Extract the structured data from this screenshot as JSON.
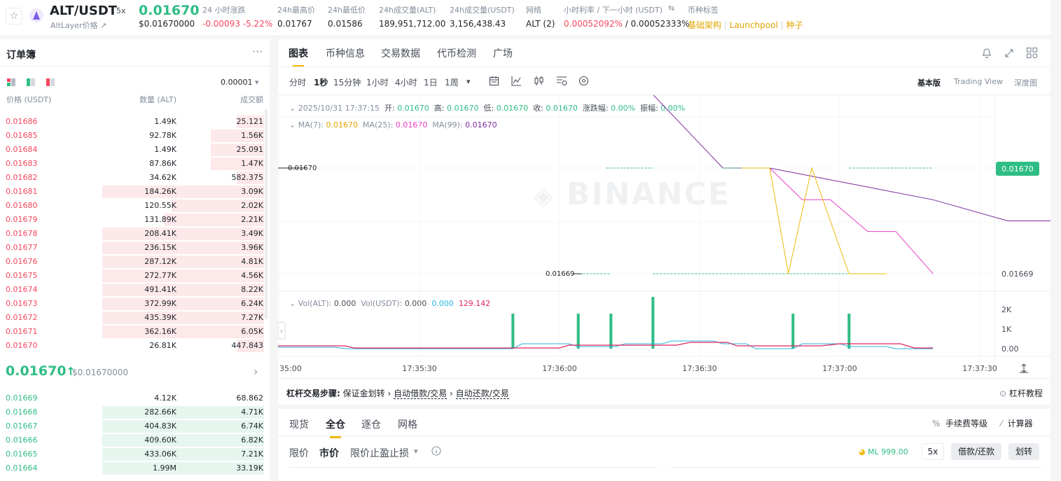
{
  "header": {
    "pair": "ALT/USDT",
    "leverage": "5x",
    "token_subtitle": "AltLayer价格",
    "price": "0.01670",
    "price_usd": "$0.01670000",
    "stats": [
      {
        "label": "24 小时涨跌",
        "value": "-0.00093 -5.22%",
        "color": "#f6465d"
      },
      {
        "label": "24h最高价",
        "value": "0.01767"
      },
      {
        "label": "24h最低价",
        "value": "0.01586"
      },
      {
        "label": "24h成交量(ALT)",
        "value": "189,951,712.00"
      },
      {
        "label": "24h成交量(USDT)",
        "value": "3,156,438.43"
      },
      {
        "label": "网络",
        "value": "ALT (2)"
      },
      {
        "label": "小时利率 / 下一小时 (USDT)",
        "value_red": "0.00052092%",
        "value_sep": " / ",
        "value_dark": "0.00052333%"
      },
      {
        "label": "币种标签",
        "tags": [
          "基础架构",
          "Launchpool",
          "种子"
        ]
      }
    ]
  },
  "orderbook": {
    "title": "订单簿",
    "precision": "0.00001",
    "columns": [
      "价格 (USDT)",
      "数量 (ALT)",
      "成交额"
    ],
    "asks": [
      {
        "price": "0.01686",
        "qty": "1.49K",
        "amount": "25.121",
        "depth": 0.17
      },
      {
        "price": "0.01685",
        "qty": "92.78K",
        "amount": "1.56K",
        "depth": 0.33
      },
      {
        "price": "0.01684",
        "qty": "1.49K",
        "amount": "25.091",
        "depth": 0.33
      },
      {
        "price": "0.01683",
        "qty": "87.86K",
        "amount": "1.47K",
        "depth": 0.33
      },
      {
        "price": "0.01682",
        "qty": "34.62K",
        "amount": "582.375",
        "depth": 0.17
      },
      {
        "price": "0.01681",
        "qty": "184.26K",
        "amount": "3.09K",
        "depth": 1.0
      },
      {
        "price": "0.01680",
        "qty": "120.55K",
        "amount": "2.02K",
        "depth": 0.57
      },
      {
        "price": "0.01679",
        "qty": "131.89K",
        "amount": "2.21K",
        "depth": 0.62
      },
      {
        "price": "0.01678",
        "qty": "208.41K",
        "amount": "3.49K",
        "depth": 1.0
      },
      {
        "price": "0.01677",
        "qty": "236.15K",
        "amount": "3.96K",
        "depth": 1.0
      },
      {
        "price": "0.01676",
        "qty": "287.12K",
        "amount": "4.81K",
        "depth": 1.0
      },
      {
        "price": "0.01675",
        "qty": "272.77K",
        "amount": "4.56K",
        "depth": 1.0
      },
      {
        "price": "0.01674",
        "qty": "491.41K",
        "amount": "8.22K",
        "depth": 1.0
      },
      {
        "price": "0.01673",
        "qty": "372.99K",
        "amount": "6.24K",
        "depth": 1.0
      },
      {
        "price": "0.01672",
        "qty": "435.39K",
        "amount": "7.27K",
        "depth": 1.0
      },
      {
        "price": "0.01671",
        "qty": "362.16K",
        "amount": "6.05K",
        "depth": 1.0
      },
      {
        "price": "0.01670",
        "qty": "26.81K",
        "amount": "447.843",
        "depth": 0.17
      }
    ],
    "mid_price": "0.01670",
    "mid_arrow": "↑",
    "mid_usd": "$0.01670000",
    "bids": [
      {
        "price": "0.01669",
        "qty": "4.12K",
        "amount": "68.862",
        "depth": 0.0
      },
      {
        "price": "0.01668",
        "qty": "282.66K",
        "amount": "4.71K",
        "depth": 1.0
      },
      {
        "price": "0.01667",
        "qty": "404.83K",
        "amount": "6.74K",
        "depth": 1.0
      },
      {
        "price": "0.01666",
        "qty": "409.60K",
        "amount": "6.82K",
        "depth": 1.0
      },
      {
        "price": "0.01665",
        "qty": "433.06K",
        "amount": "7.21K",
        "depth": 1.0
      },
      {
        "price": "0.01664",
        "qty": "1.99M",
        "amount": "33.19K",
        "depth": 1.0
      }
    ]
  },
  "main_tabs": [
    "图表",
    "币种信息",
    "交易数据",
    "代币检测",
    "广场"
  ],
  "intervals": [
    "分时",
    "1秒",
    "15分钟",
    "1小时",
    "4小时",
    "1日",
    "1周"
  ],
  "view_modes": [
    "基本版",
    "Trading View",
    "深度图"
  ],
  "candle_info": {
    "date": "2025/10/31 17:37:15",
    "open_label": "开:",
    "open": "0.01670",
    "high_label": "高:",
    "high": "0.01670",
    "low_label": "低:",
    "low": "0.01670",
    "close_label": "收:",
    "close": "0.01670",
    "change_label": "涨跌幅:",
    "change": "0.00%",
    "amp_label": "振幅:",
    "amp": "0.00%"
  },
  "ma_info": {
    "ma7_label": "MA(7):",
    "ma7": "0.01670",
    "ma25_label": "MA(25):",
    "ma25": "0.01670",
    "ma99_label": "MA(99):",
    "ma99": "0.01670"
  },
  "vol_info": {
    "vol_label": "Vol(ALT):",
    "vol": "0.000",
    "volu_label": "Vol(USDT):",
    "volu": "0.000",
    "v1": "0.000",
    "v2": "129.142"
  },
  "watermark": "BINANCE",
  "chart_data": {
    "type": "line",
    "x_ticks": [
      "35:00",
      "17:35:30",
      "17:36:00",
      "17:36:30",
      "17:37:00",
      "17:37:30"
    ],
    "y_labels": [
      "0.01670",
      "0.01669"
    ],
    "current_price": "0.01670",
    "marker_high": "0.01670",
    "marker_low": "0.01669",
    "vol_ticks": [
      "2K",
      "1K",
      "0.00"
    ],
    "colors": {
      "ma7": "#f0b90b",
      "ma25": "#e63fc3",
      "ma99": "#7b2a9e",
      "volume": "#2ebd85"
    },
    "series": [
      {
        "name": "MA(7)",
        "t": [
          99,
          105,
          109,
          114,
          122,
          130
        ],
        "y": [
          0.0167,
          0.0167,
          0.01669,
          0.0167,
          0.01669,
          0.01669
        ]
      },
      {
        "name": "MA(25)",
        "t": [
          99,
          105,
          112,
          118,
          126,
          132,
          140
        ],
        "y": [
          0.0167,
          0.0167,
          0.016697,
          0.016697,
          0.016694,
          0.016694,
          0.01669
        ]
      },
      {
        "name": "MA(99)",
        "t": [
          1,
          15,
          30,
          54,
          95,
          105,
          140,
          156,
          180
        ],
        "y": [
          0.016725,
          0.016725,
          0.016719,
          0.016719,
          0.0167,
          0.0167,
          0.016697,
          0.016695,
          0.016695
        ]
      }
    ]
  },
  "margin_steps": {
    "title": "杠杆交易步骤:",
    "steps": [
      "保证金划转",
      "自动借款/交易",
      "自动还款/交易"
    ],
    "tutorial": "杠杆教程"
  },
  "trade": {
    "tabs": [
      "现货",
      "全仓",
      "逐仓",
      "网格"
    ],
    "fee_label": "手续费等级",
    "calc_label": "计算器",
    "order_types": [
      "限价",
      "市价",
      "限价止盈止损"
    ],
    "ml": "ML 999.00",
    "leverage": "5x",
    "borrow_repay": "借款/还款",
    "transfer": "划转"
  }
}
